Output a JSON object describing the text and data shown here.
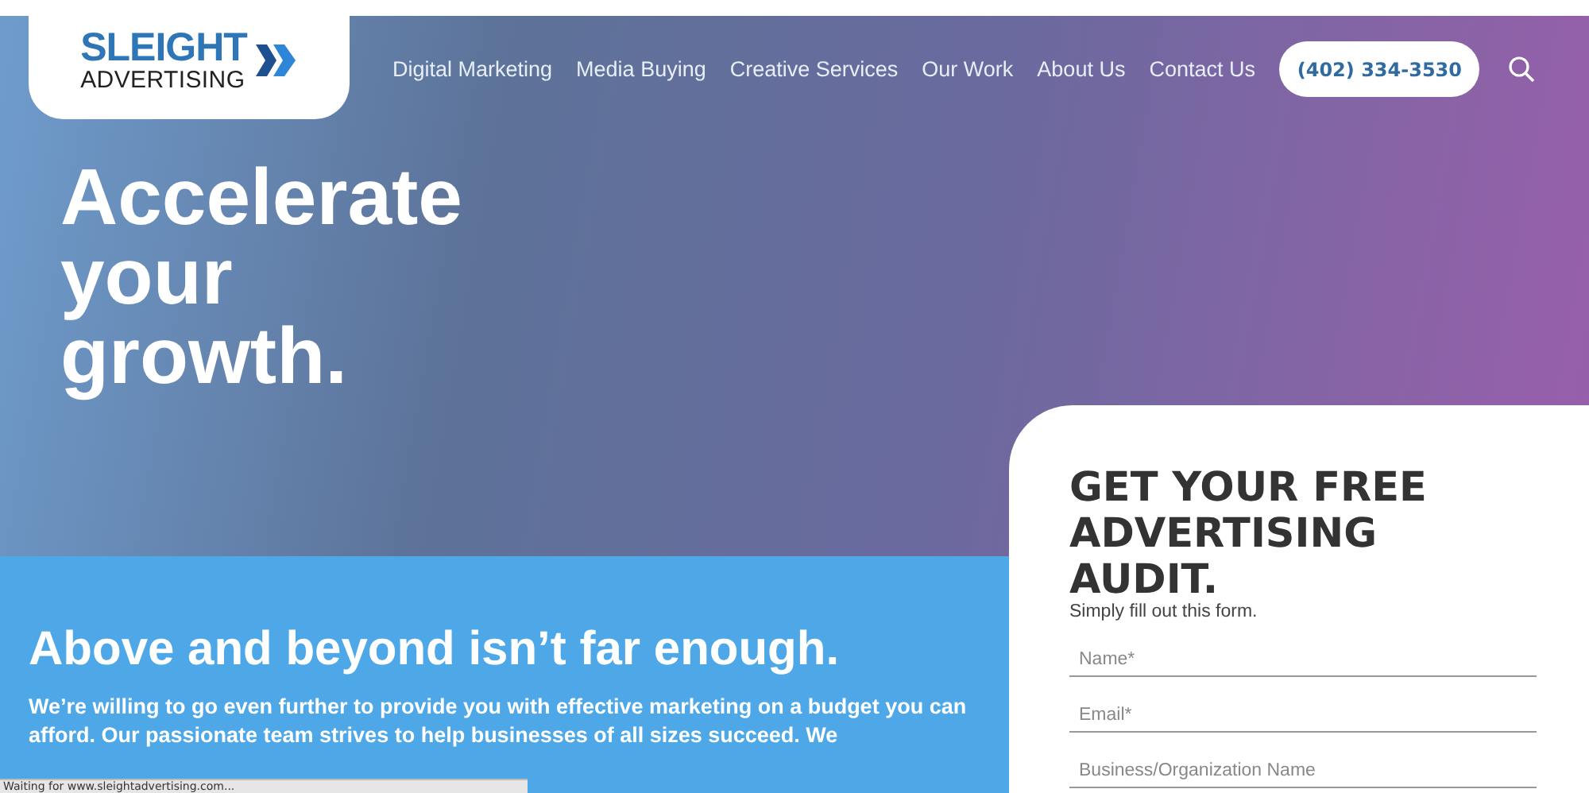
{
  "logo": {
    "name": "SLEIGHT",
    "subtitle": "ADVERTISING"
  },
  "nav": [
    {
      "label": "Digital Marketing"
    },
    {
      "label": "Media Buying"
    },
    {
      "label": "Creative Services"
    },
    {
      "label": "Our Work"
    },
    {
      "label": "About Us"
    },
    {
      "label": "Contact Us"
    }
  ],
  "phone": "(402) 334-3530",
  "hero": {
    "headline": [
      "Accelerate",
      "your",
      "growth."
    ]
  },
  "section": {
    "heading": "Above and beyond isn’t far enough.",
    "paragraph": "We’re willing to go even further to provide you with effective marketing on a budget you can afford. Our passionate team strives to help businesses of all sizes succeed. We"
  },
  "form": {
    "title": "GET YOUR FREE ADVERTISING AUDIT.",
    "subtitle": "Simply fill out this form.",
    "fields": [
      {
        "placeholder": "Name*"
      },
      {
        "placeholder": "Email*"
      },
      {
        "placeholder": "Business/Organization Name"
      }
    ]
  },
  "status_bar": "Waiting for www.sleightadvertising.com..."
}
